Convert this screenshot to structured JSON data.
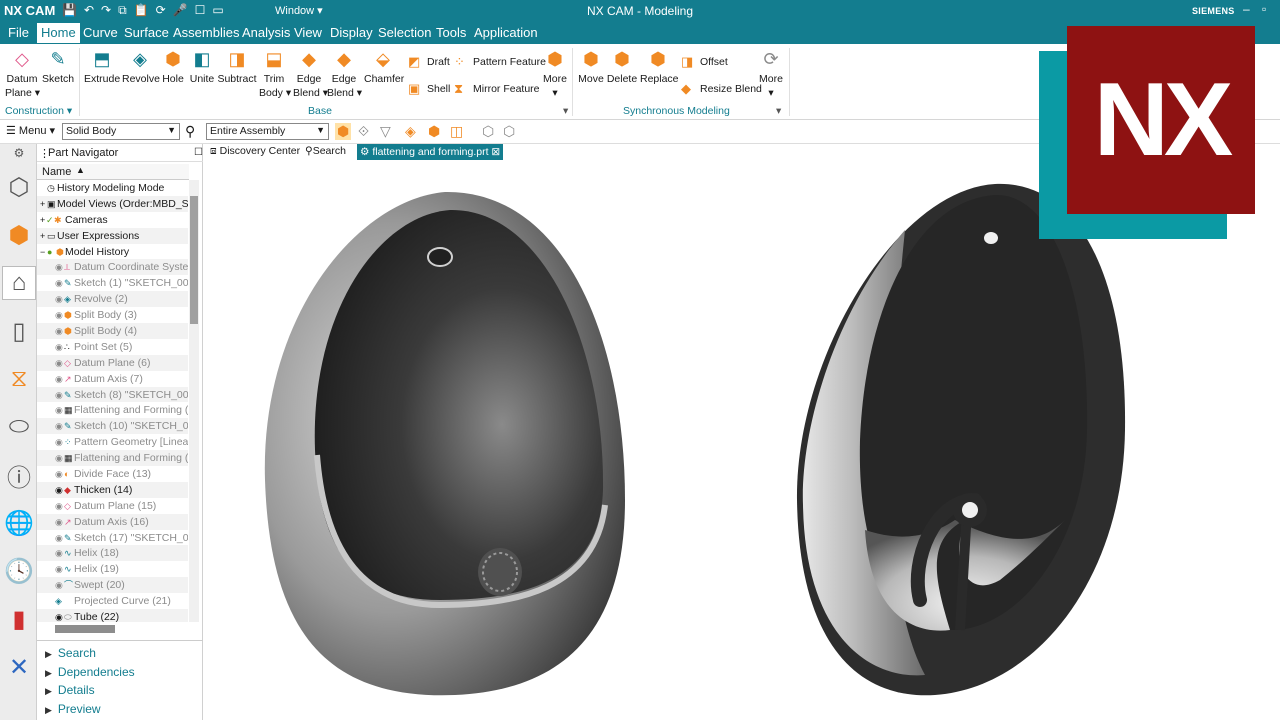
{
  "titlebar": {
    "brand": "NX CAM",
    "window_menu": "Window",
    "title": "NX CAM - Modeling",
    "vendor": "SIEMENS"
  },
  "menubar": {
    "tabs": [
      "File",
      "Home",
      "Curve",
      "Surface",
      "Assemblies",
      "Analysis",
      "View",
      "Display",
      "Selection",
      "Tools",
      "Application"
    ],
    "active": "Home"
  },
  "ribbon": {
    "datum_plane": [
      "Datum",
      "Plane"
    ],
    "sketch": "Sketch",
    "extrude": "Extrude",
    "revolve": "Revolve",
    "hole": "Hole",
    "unite": "Unite",
    "subtract": "Subtract",
    "trim_body": [
      "Trim",
      "Body"
    ],
    "edge_blend": [
      "Edge",
      "Blend"
    ],
    "edge_blend2": [
      "Edge",
      "Blend"
    ],
    "chamfer": "Chamfer",
    "draft": "Draft",
    "shell": "Shell",
    "pattern_feature": "Pattern Feature",
    "mirror_feature": "Mirror Feature",
    "more1": "More",
    "move": "Move",
    "delete": "Delete",
    "replace": "Replace",
    "offset": "Offset",
    "resize_blend": "Resize Blend",
    "more2": "More",
    "groups": {
      "construction": "Construction",
      "base": "Base",
      "synchronous": "Synchronous Modeling"
    }
  },
  "selection_bar": {
    "menu": "Menu",
    "filter": "Solid Body",
    "scope": "Entire Assembly"
  },
  "part_navigator": {
    "title": "Part Navigator",
    "column": "Name",
    "rows": [
      "History Modeling Mode",
      "Model Views (Order:MBD_SC",
      "Cameras",
      "User Expressions",
      "Model History",
      "Datum Coordinate Syster",
      "Sketch (1) \"SKETCH_000\"",
      "Revolve (2)",
      "Split Body (3)",
      "Split Body (4)",
      "Point Set (5)",
      "Datum Plane (6)",
      "Datum Axis (7)",
      "Sketch (8) \"SKETCH_001\"",
      "Flattening and Forming (9",
      "Sketch (10) \"SKETCH_002'",
      "Pattern Geometry [Linear",
      "Flattening and Forming (1",
      "Divide Face (13)",
      "Thicken (14)",
      "Datum Plane (15)",
      "Datum Axis (16)",
      "Sketch (17) \"SKETCH_003'",
      "Helix (18)",
      "Helix (19)",
      "Swept (20)",
      "Projected Curve (21)",
      "Tube (22)"
    ],
    "panels": [
      "Search",
      "Dependencies",
      "Details",
      "Preview"
    ]
  },
  "doc_tabs": {
    "discovery": "Discovery Center",
    "search": "Search",
    "file": "flattening and forming.prt"
  },
  "logo": {
    "text": "NX"
  },
  "colors": {
    "accent": "#137d8f",
    "logo_red": "#8e1212",
    "logo_teal": "#0b9aa4"
  }
}
